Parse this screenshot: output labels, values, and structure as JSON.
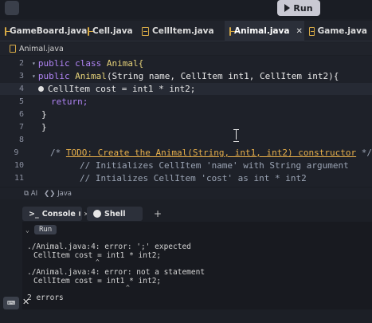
{
  "toolbar": {
    "run_label": "Run"
  },
  "tabs": [
    {
      "label": "GameBoard.java"
    },
    {
      "label": "Cell.java"
    },
    {
      "label": "CellItem.java"
    },
    {
      "label": "Animal.java",
      "active": true
    },
    {
      "label": "Game.java"
    }
  ],
  "breadcrumb": "Animal.java",
  "editor": {
    "lines": [
      {
        "n": "2",
        "kw": "public class ",
        "rest": "Animal{"
      },
      {
        "n": "3",
        "kw": "public ",
        "name": "Animal",
        "params": "(String name, CellItem int1, CellItem int2){"
      },
      {
        "n": "4",
        "text": "CellItem cost = int1 * int2;"
      },
      {
        "n": "5",
        "text": "return;"
      },
      {
        "n": "6",
        "text": "}"
      },
      {
        "n": "7",
        "text": "}"
      },
      {
        "n": "8",
        "text": ""
      },
      {
        "n": "9",
        "prefix": "/* ",
        "todo": "TODO: Create the Animal(String, int1, int2) constructor",
        "suffix": " */"
      },
      {
        "n": "10",
        "text": "// Initializes CellItem 'name' with String argument"
      },
      {
        "n": "11",
        "text": "// Intializes CellItem 'cost' as int * int2"
      }
    ]
  },
  "statusbar": {
    "ai": "AI",
    "lang": "Java"
  },
  "console": {
    "tab_console": "Console",
    "tab_shell": "Shell",
    "add_tab": "+",
    "run_label": "Run",
    "errors": [
      {
        "msg": "./Animal.java:4: error: ';' expected",
        "code": "CellItem cost = int1 * int2;"
      },
      {
        "msg": "./Animal.java:4: error: not a statement",
        "code": "CellItem cost = int1 * int2;"
      }
    ],
    "summary": "2 errors"
  },
  "colors": {
    "keyword": "#b084f5",
    "type": "#e7d37a",
    "comment": "#9aa3b3",
    "todo": "#e8b04b",
    "file_icon": "#d6a945"
  }
}
